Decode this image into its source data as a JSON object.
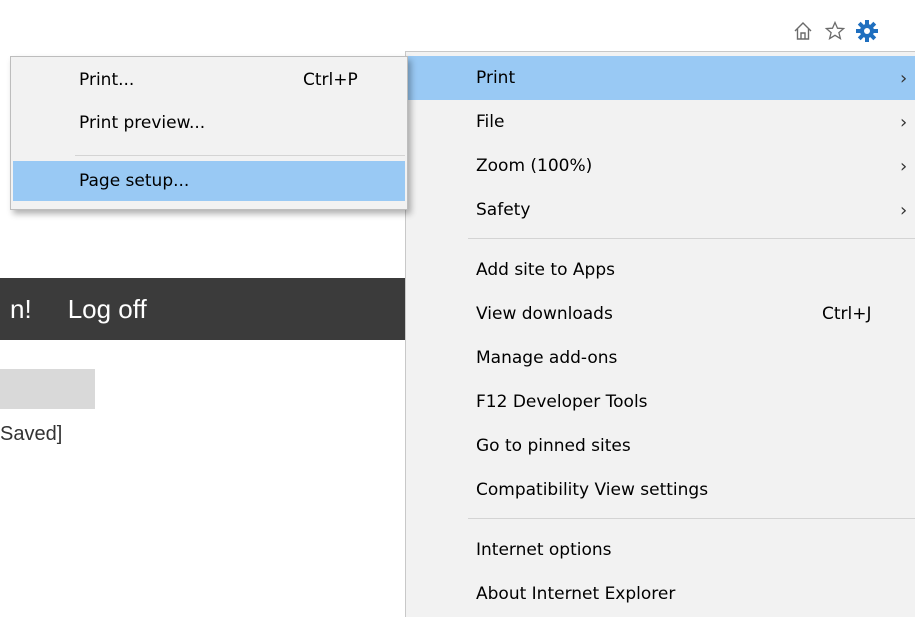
{
  "toolbar": {
    "icons": [
      "home-icon",
      "favorites-star-icon",
      "tools-gear-icon"
    ]
  },
  "page": {
    "greeting_fragment": "n!",
    "logoff_label": "Log off",
    "saved_text": "Saved]"
  },
  "tools_menu": {
    "items": [
      {
        "label": "Print",
        "shortcut": "",
        "arrow": "›"
      },
      {
        "label": "File",
        "shortcut": "",
        "arrow": "›"
      },
      {
        "label": "Zoom (100%)",
        "shortcut": "",
        "arrow": "›"
      },
      {
        "label": "Safety",
        "shortcut": "",
        "arrow": "›"
      },
      {
        "label": "Add site to Apps",
        "shortcut": ""
      },
      {
        "label": "View downloads",
        "shortcut": "Ctrl+J"
      },
      {
        "label": "Manage add-ons",
        "shortcut": ""
      },
      {
        "label": "F12 Developer Tools",
        "shortcut": ""
      },
      {
        "label": "Go to pinned sites",
        "shortcut": ""
      },
      {
        "label": "Compatibility View settings",
        "shortcut": ""
      },
      {
        "label": "Internet options",
        "shortcut": ""
      },
      {
        "label": "About Internet Explorer",
        "shortcut": ""
      }
    ]
  },
  "print_submenu": {
    "items": [
      {
        "label": "Print...",
        "shortcut": "Ctrl+P"
      },
      {
        "label": "Print preview...",
        "shortcut": ""
      },
      {
        "label": "Page setup...",
        "shortcut": ""
      }
    ]
  },
  "colors": {
    "highlight": "#99c9f4",
    "menu_background": "#f2f2f2",
    "dark_bar": "#3b3b3b",
    "gear_icon": "#1f6fbf"
  }
}
